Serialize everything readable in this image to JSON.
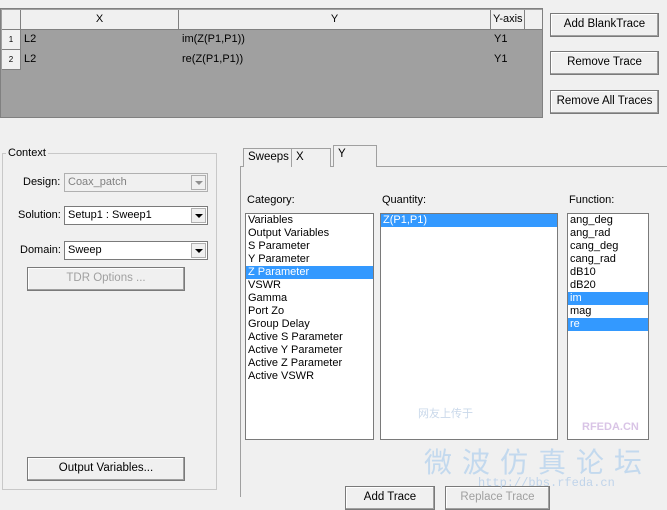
{
  "traces_grid": {
    "headers": [
      "X",
      "Y",
      "Y-axis"
    ],
    "rows": [
      {
        "num": "1",
        "x": "L2",
        "y": "im(Z(P1,P1))",
        "axis": "Y1"
      },
      {
        "num": "2",
        "x": "L2",
        "y": "re(Z(P1,P1))",
        "axis": "Y1"
      }
    ]
  },
  "trace_buttons": {
    "add_blank": "Add BlankTrace",
    "remove": "Remove Trace",
    "remove_all": "Remove All Traces"
  },
  "context": {
    "title": "Context",
    "design_label": "Design:",
    "design_value": "Coax_patch",
    "solution_label": "Solution:",
    "solution_value": "Setup1 : Sweep1",
    "domain_label": "Domain:",
    "domain_value": "Sweep",
    "tdr_button": "TDR Options ...",
    "output_variables_button": "Output Variables..."
  },
  "tabs": [
    "Sweeps",
    "X",
    "Y"
  ],
  "active_tab": "Y",
  "category": {
    "label": "Category:",
    "items": [
      "Variables",
      "Output Variables",
      "S Parameter",
      "Y Parameter",
      "Z Parameter",
      "VSWR",
      "Gamma",
      "Port Zo",
      "Group Delay",
      "Active S Parameter",
      "Active Y Parameter",
      "Active Z Parameter",
      "Active VSWR"
    ],
    "selected": "Z Parameter"
  },
  "quantity": {
    "label": "Quantity:",
    "items": [
      "Z(P1,P1)"
    ],
    "selected": "Z(P1,P1)"
  },
  "function": {
    "label": "Function:",
    "items": [
      "ang_deg",
      "ang_rad",
      "cang_deg",
      "cang_rad",
      "dB10",
      "dB20",
      "im",
      "mag",
      "re"
    ],
    "selected": [
      "im",
      "re"
    ]
  },
  "bottom_buttons": {
    "add_trace": "Add Trace",
    "replace_trace": "Replace Trace"
  },
  "watermark": {
    "site": "RFEDA.CN",
    "url": "http://bbs.rfeda.cn",
    "cn_title": "微波仿真论坛",
    "cn_small": "网友上传于"
  },
  "colors": {
    "selection": "#3399ff",
    "grid_bg": "#a0a0a0",
    "window_bg": "#f0f0f0"
  }
}
